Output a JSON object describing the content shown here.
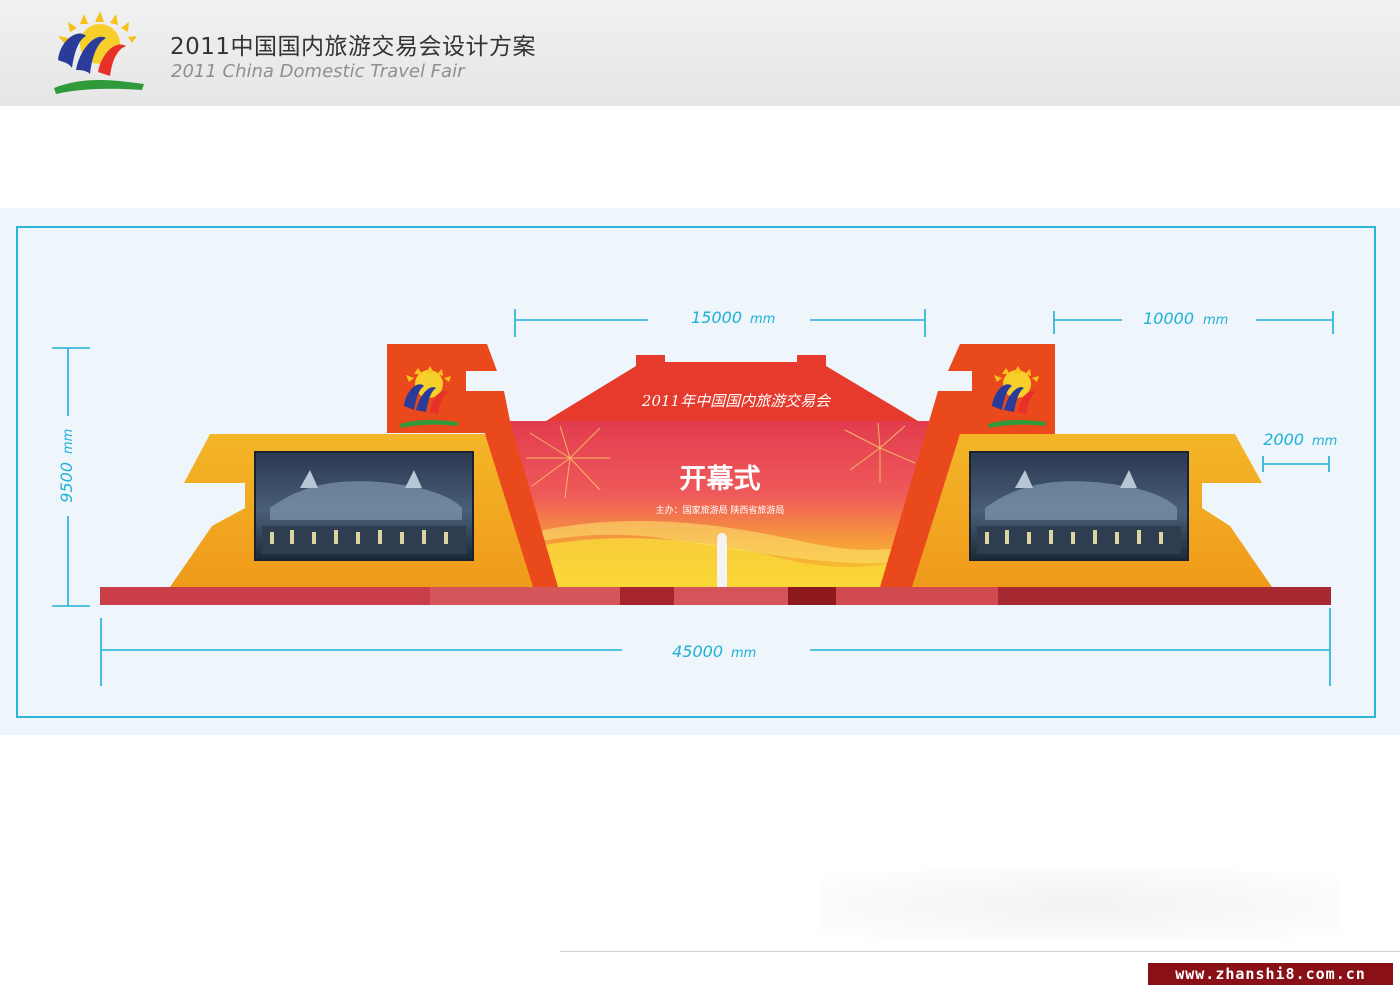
{
  "header": {
    "title_cn": "2011中国国内旅游交易会设计方案",
    "title_en": "2011 China Domestic Travel Fair"
  },
  "stage": {
    "banner_title": "2011年中国国内旅游交易会",
    "main_title": "开幕式",
    "organizers": "主办：国家旅游局  陕西省旅游局"
  },
  "dimensions": {
    "center_width": "15000",
    "right_wing_width": "10000",
    "side_step_width": "2000",
    "height": "9500",
    "total_width": "45000",
    "unit": "mm"
  },
  "watermark": "www.zhanshi8.com.cn",
  "colors": {
    "accent_cyan": "#1fb1d6",
    "wing_orange": "#f3a41e",
    "tower_red": "#ea4a1b",
    "platform_red": "#c83a42",
    "header_bg": "#ececec"
  }
}
